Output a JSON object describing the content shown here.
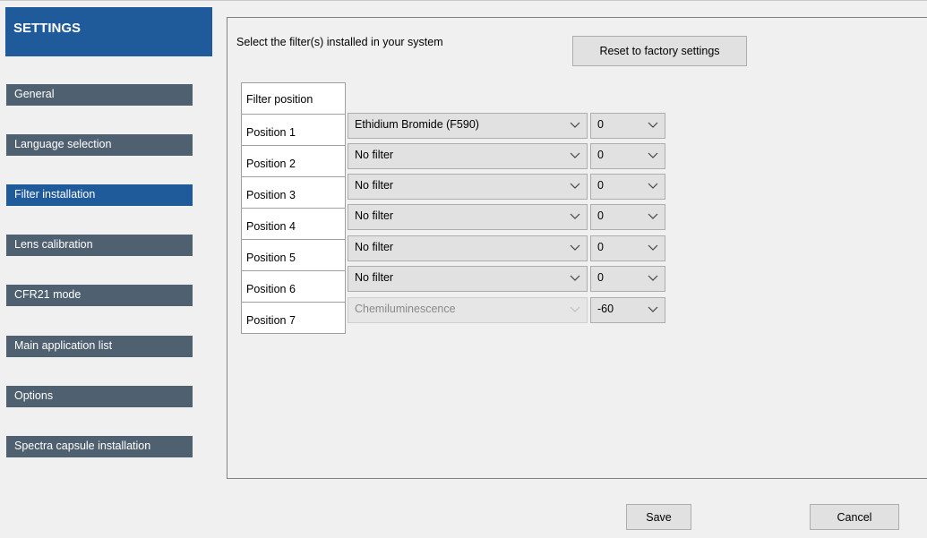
{
  "sidebar": {
    "title": "SETTINGS",
    "items": [
      {
        "label": "General"
      },
      {
        "label": "Language selection"
      },
      {
        "label": "Filter installation",
        "active": true
      },
      {
        "label": "Lens calibration"
      },
      {
        "label": "CFR21 mode"
      },
      {
        "label": "Main application list"
      },
      {
        "label": "Options"
      },
      {
        "label": "Spectra capsule installation"
      }
    ]
  },
  "main": {
    "instructions": "Select the filter(s) installed in your system",
    "reset_button": "Reset to factory settings",
    "table_header": "Filter position",
    "rows": [
      {
        "position": "Position 1",
        "filter": "Ethidium Bromide (F590)",
        "value": "0",
        "disabled": false
      },
      {
        "position": "Position 2",
        "filter": "No filter",
        "value": "0",
        "disabled": false
      },
      {
        "position": "Position 3",
        "filter": "No filter",
        "value": "0",
        "disabled": false
      },
      {
        "position": "Position 4",
        "filter": "No filter",
        "value": "0",
        "disabled": false
      },
      {
        "position": "Position 5",
        "filter": "No filter",
        "value": "0",
        "disabled": false
      },
      {
        "position": "Position 6",
        "filter": "No filter",
        "value": "0",
        "disabled": false
      },
      {
        "position": "Position 7",
        "filter": "Chemiluminescence",
        "value": "-60",
        "disabled": true
      }
    ]
  },
  "footer": {
    "save_button": "Save",
    "cancel_button": "Cancel"
  },
  "colors": {
    "accent": "#1f5a9a",
    "sidebar_item": "#4f6070",
    "background": "#f0f0f0"
  }
}
